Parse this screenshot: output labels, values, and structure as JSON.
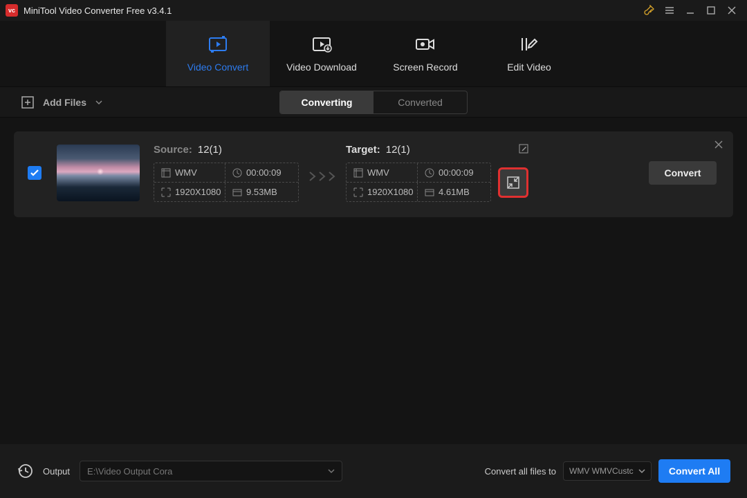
{
  "app": {
    "title": "MiniTool Video Converter Free v3.4.1"
  },
  "nav": {
    "convert": "Video Convert",
    "download": "Video Download",
    "record": "Screen Record",
    "edit": "Edit Video"
  },
  "toolbar": {
    "add_files": "Add Files",
    "converting": "Converting",
    "converted": "Converted"
  },
  "item": {
    "source_label": "Source:",
    "source_name": "12(1)",
    "source": {
      "format": "WMV",
      "duration": "00:00:09",
      "resolution": "1920X1080",
      "size": "9.53MB"
    },
    "target_label": "Target:",
    "target_name": "12(1)",
    "target": {
      "format": "WMV",
      "duration": "00:00:09",
      "resolution": "1920X1080",
      "size": "4.61MB"
    },
    "convert": "Convert"
  },
  "footer": {
    "output_label": "Output",
    "output_path": "E:\\Video Output Cora",
    "convert_all_to": "Convert all files to",
    "format_selected": "WMV WMVCustc",
    "convert_all": "Convert All"
  }
}
